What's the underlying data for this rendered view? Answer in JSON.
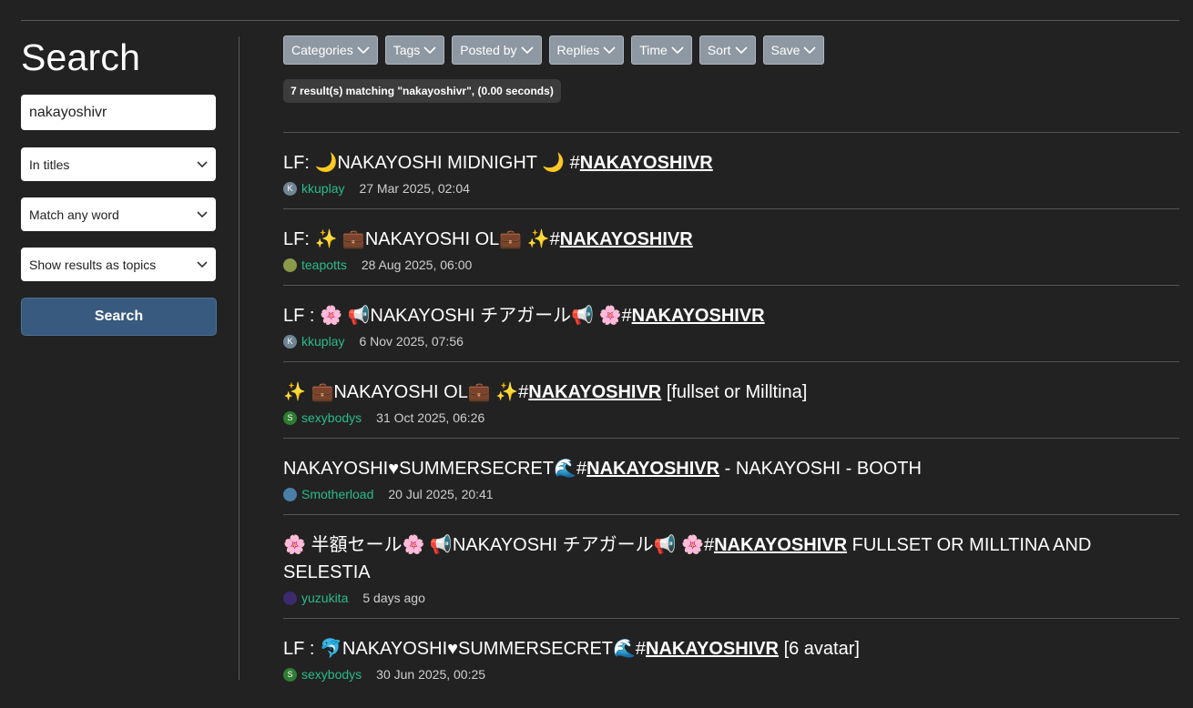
{
  "sidebar": {
    "title": "Search",
    "search_value": "nakayoshivr",
    "scope_select": "In titles",
    "match_select": "Match any word",
    "display_select": "Show results as topics",
    "search_button": "Search"
  },
  "filters": [
    "Categories",
    "Tags",
    "Posted by",
    "Replies",
    "Time",
    "Sort",
    "Save"
  ],
  "result_count": "7 result(s) matching \"nakayoshivr\", (0.00 seconds)",
  "colors": {
    "background": "#222222",
    "accent_button": "#385a7e",
    "username": "#2bbc8a",
    "filter_button": "#8e98a2"
  },
  "results": [
    {
      "title_before": "LF: 🌙NAKAYOSHI MIDNIGHT 🌙  #",
      "tag": "NAKAYOSHIVR",
      "title_after": "",
      "avatar_letter": "K",
      "avatar_color": "#6f8594",
      "user": "kkuplay",
      "date": "27 Mar 2025, 02:04"
    },
    {
      "title_before": "LF: ✨ 💼NAKAYOSHI OL💼 ✨#",
      "tag": "NAKAYOSHIVR",
      "title_after": "",
      "avatar_letter": "",
      "avatar_color": "#8a9a4a",
      "user": "teapotts",
      "date": "28 Aug 2025, 06:00"
    },
    {
      "title_before": "LF : 🌸 📢NAKAYOSHI チアガール📢 🌸#",
      "tag": "NAKAYOSHIVR",
      "title_after": "",
      "avatar_letter": "K",
      "avatar_color": "#6f8594",
      "user": "kkuplay",
      "date": "6 Nov 2025, 07:56"
    },
    {
      "title_before": "✨ 💼NAKAYOSHI OL💼 ✨#",
      "tag": "NAKAYOSHIVR",
      "title_after": " [fullset or Milltina]",
      "avatar_letter": "S",
      "avatar_color": "#2e7d32",
      "user": "sexybodys",
      "date": "31 Oct 2025, 06:26"
    },
    {
      "title_before": "NAKAYOSHI♥SUMMERSECRET🌊#",
      "tag": "NAKAYOSHIVR",
      "title_after": " - NAKAYOSHI - BOOTH",
      "avatar_letter": "",
      "avatar_color": "#4a7fa8",
      "user": "Smotherload",
      "date": "20 Jul 2025, 20:41"
    },
    {
      "title_before": "🌸 半額セール🌸 📢NAKAYOSHI チアガール📢 🌸#",
      "tag": "NAKAYOSHIVR",
      "title_after": " FULLSET OR MILLTINA AND SELESTIA",
      "avatar_letter": "",
      "avatar_color": "#3b2a6e",
      "user": "yuzukita",
      "date": "5 days ago"
    },
    {
      "title_before": "LF : 🐬NAKAYOSHI♥SUMMERSECRET🌊#",
      "tag": "NAKAYOSHIVR",
      "title_after": " [6 avatar]",
      "avatar_letter": "S",
      "avatar_color": "#2e7d32",
      "user": "sexybodys",
      "date": "30 Jun 2025, 00:25"
    }
  ]
}
